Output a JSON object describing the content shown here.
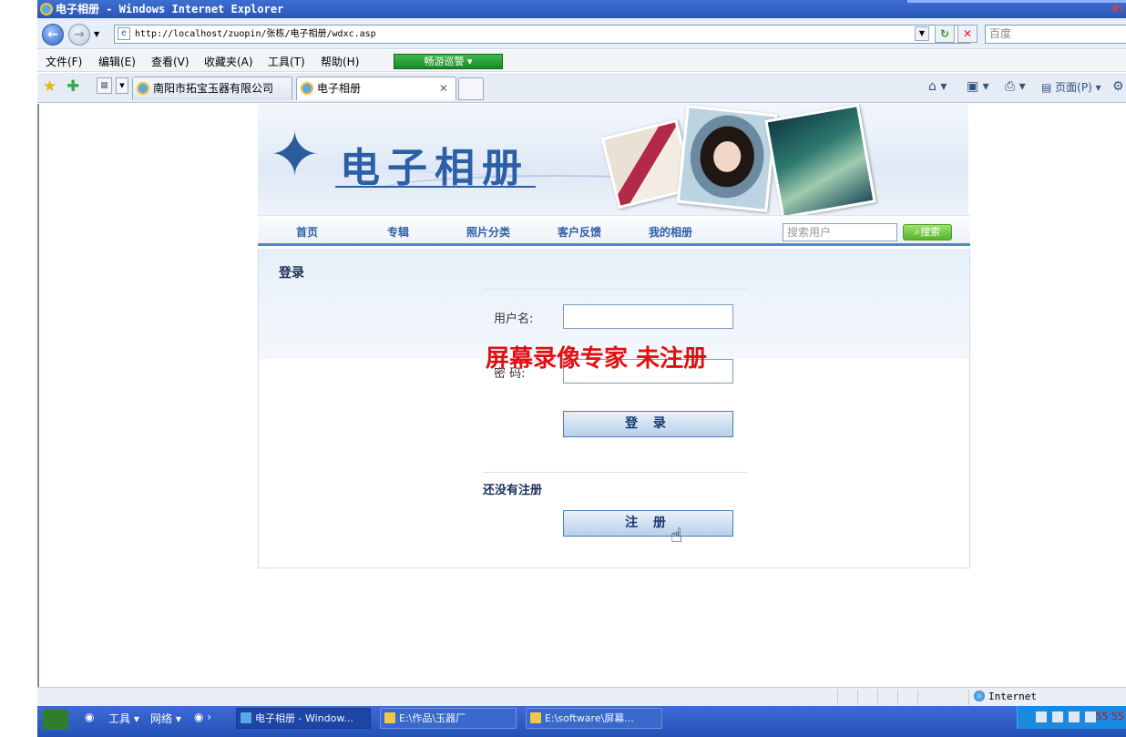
{
  "window": {
    "title": "电子相册 - Windows Internet Explorer",
    "corner_text": "0:"
  },
  "address_bar": {
    "url": "http://localhost/zuopin/张栋/电子相册/wdxc.asp",
    "search_placeholder": "百度"
  },
  "menu": {
    "items": [
      "文件(F)",
      "编辑(E)",
      "查看(V)",
      "收藏夹(A)",
      "工具(T)",
      "帮助(H)"
    ],
    "toolbar_button": "畅游巡警"
  },
  "tabs": [
    {
      "label": "南阳市拓宝玉器有限公司",
      "active": false
    },
    {
      "label": "电子相册",
      "active": true
    }
  ],
  "toolbar_right": {
    "page_label": "页面(P)"
  },
  "site": {
    "title": "电子相册",
    "nav": [
      "首页",
      "专辑",
      "照片分类",
      "客户反馈",
      "我的相册"
    ],
    "user_search_placeholder": "搜索用户",
    "user_search_button": "搜索"
  },
  "login": {
    "heading": "登录",
    "username_label": "用户名:",
    "password_label": "密 码:",
    "login_button": "登 录",
    "register_prompt": "还没有注册",
    "register_button": "注 册"
  },
  "watermark": "屏幕录像专家 未注册",
  "status": {
    "zone": "Internet"
  },
  "taskbar": {
    "quick_tools": "工具",
    "quick_network": "网络",
    "items": [
      {
        "label": "电子相册 - Window...",
        "active": true
      },
      {
        "label": "E:\\作品\\玉器厂",
        "active": false
      },
      {
        "label": "E:\\software\\屏幕...",
        "active": false
      }
    ],
    "clock": "55 55"
  },
  "colors": {
    "accent": "#2d5fa6",
    "nav_underline": "#4d89c8",
    "watermark": "#e01010",
    "taskbar": "#2451b6"
  }
}
